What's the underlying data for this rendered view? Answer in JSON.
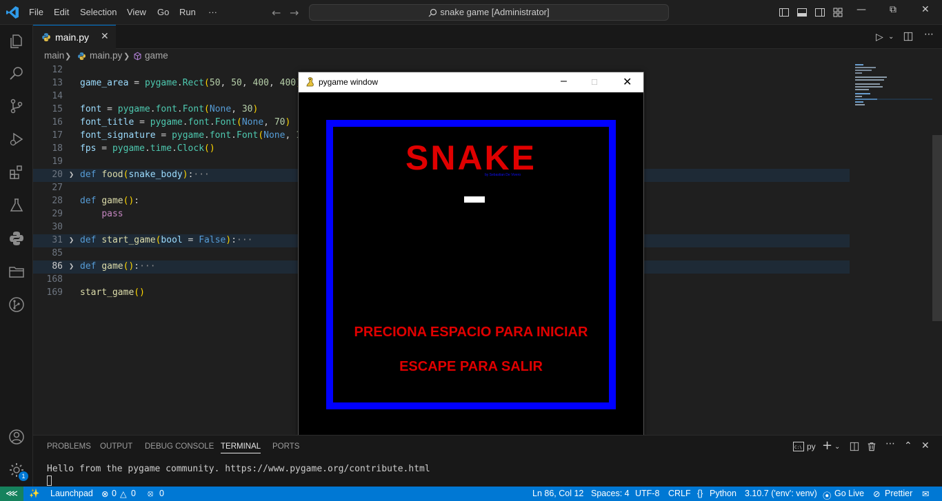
{
  "titlebar": {
    "menu": [
      "File",
      "Edit",
      "Selection",
      "View",
      "Go",
      "Run",
      "···"
    ],
    "command_center": "snake game [Administrator]"
  },
  "tab": {
    "label": "main.py",
    "close": "✕"
  },
  "breadcrumbs": [
    "main",
    "main.py",
    "game"
  ],
  "code_lines": [
    {
      "num": "12",
      "html": ""
    },
    {
      "num": "13",
      "html": "<span class=\"var\">game_area</span> = <span class=\"cls\">pygame</span>.<span class=\"cls\">Rect</span><span class=\"punc\">(</span><span class=\"num\">50</span>, <span class=\"num\">50</span>, <span class=\"num\">400</span>, <span class=\"num\">400</span><span class=\"punc\">)</span>"
    },
    {
      "num": "14",
      "html": ""
    },
    {
      "num": "15",
      "html": "<span class=\"var\">font</span> = <span class=\"cls\">pygame</span>.<span class=\"cls\">font</span>.<span class=\"cls\">Font</span><span class=\"punc\">(</span><span class=\"kw\">None</span>, <span class=\"num\">30</span><span class=\"punc\">)</span>"
    },
    {
      "num": "16",
      "html": "<span class=\"var\">font_title</span> = <span class=\"cls\">pygame</span>.<span class=\"cls\">font</span>.<span class=\"cls\">Font</span><span class=\"punc\">(</span><span class=\"kw\">None</span>, <span class=\"num\">70</span><span class=\"punc\">)</span>"
    },
    {
      "num": "17",
      "html": "<span class=\"var\">font_signature</span> = <span class=\"cls\">pygame</span>.<span class=\"cls\">font</span>.<span class=\"cls\">Font</span><span class=\"punc\">(</span><span class=\"kw\">None</span>, <span class=\"num\">10</span><span class=\"punc\">)</span>"
    },
    {
      "num": "18",
      "html": "<span class=\"var\">fps</span> = <span class=\"cls\">pygame</span>.<span class=\"cls\">time</span>.<span class=\"cls\">Clock</span><span class=\"punc\">()</span>"
    },
    {
      "num": "19",
      "html": ""
    },
    {
      "num": "20",
      "fold": true,
      "hl": true,
      "html": "<span class=\"kw\">def</span> <span class=\"fn\">food</span><span class=\"punc\">(</span><span class=\"var\">snake_body</span><span class=\"punc\">)</span>:<span class=\"ell\">···</span>"
    },
    {
      "num": "27",
      "html": ""
    },
    {
      "num": "28",
      "html": "<span class=\"kw\">def</span> <span class=\"fn\">game</span><span class=\"punc\">()</span>:"
    },
    {
      "num": "29",
      "html": "    <span class=\"ctl\">pass</span>"
    },
    {
      "num": "30",
      "html": ""
    },
    {
      "num": "31",
      "fold": true,
      "hl": true,
      "html": "<span class=\"kw\">def</span> <span class=\"fn\">start_game</span><span class=\"punc\">(</span><span class=\"var\">bool</span> = <span class=\"bool\">False</span><span class=\"punc\">)</span>:<span class=\"ell\">···</span>"
    },
    {
      "num": "85",
      "html": ""
    },
    {
      "num": "86",
      "fold": true,
      "hl": true,
      "active": true,
      "html": "<span class=\"kw\">def</span> <span class=\"fn\">game</span><span class=\"punc\">()</span>:<span class=\"ell\">···</span>"
    },
    {
      "num": "168",
      "html": ""
    },
    {
      "num": "169",
      "html": "<span class=\"fn\">start_game</span><span class=\"punc\">()</span>"
    }
  ],
  "pygame": {
    "window_title": "pygame window",
    "title": "SNAKE",
    "signature": "by Sebastian De Vivero",
    "start_message": "PRECIONA ESPACIO PARA INICIAR",
    "exit_message": "ESCAPE PARA SALIR"
  },
  "panel": {
    "tabs": [
      "PROBLEMS",
      "OUTPUT",
      "DEBUG CONSOLE",
      "TERMINAL",
      "PORTS"
    ],
    "active_tab": "TERMINAL",
    "terminal_name": "py",
    "terminal_output": "Hello from the pygame community. https://www.pygame.org/contribute.html"
  },
  "statusbar": {
    "launchpad": "Launchpad",
    "errors": "0",
    "warnings": "0",
    "ports": "0",
    "position": "Ln 86, Col 12",
    "spaces": "Spaces: 4",
    "encoding": "UTF-8",
    "eol": "CRLF",
    "language": "Python",
    "interpreter": "3.10.7 ('env': venv)",
    "go_live": "Go Live",
    "prettier": "Prettier"
  },
  "accounts_badge": "1",
  "colors": {
    "accent": "#0078d4",
    "game_border": "#0000ff",
    "game_text": "#e00000"
  }
}
